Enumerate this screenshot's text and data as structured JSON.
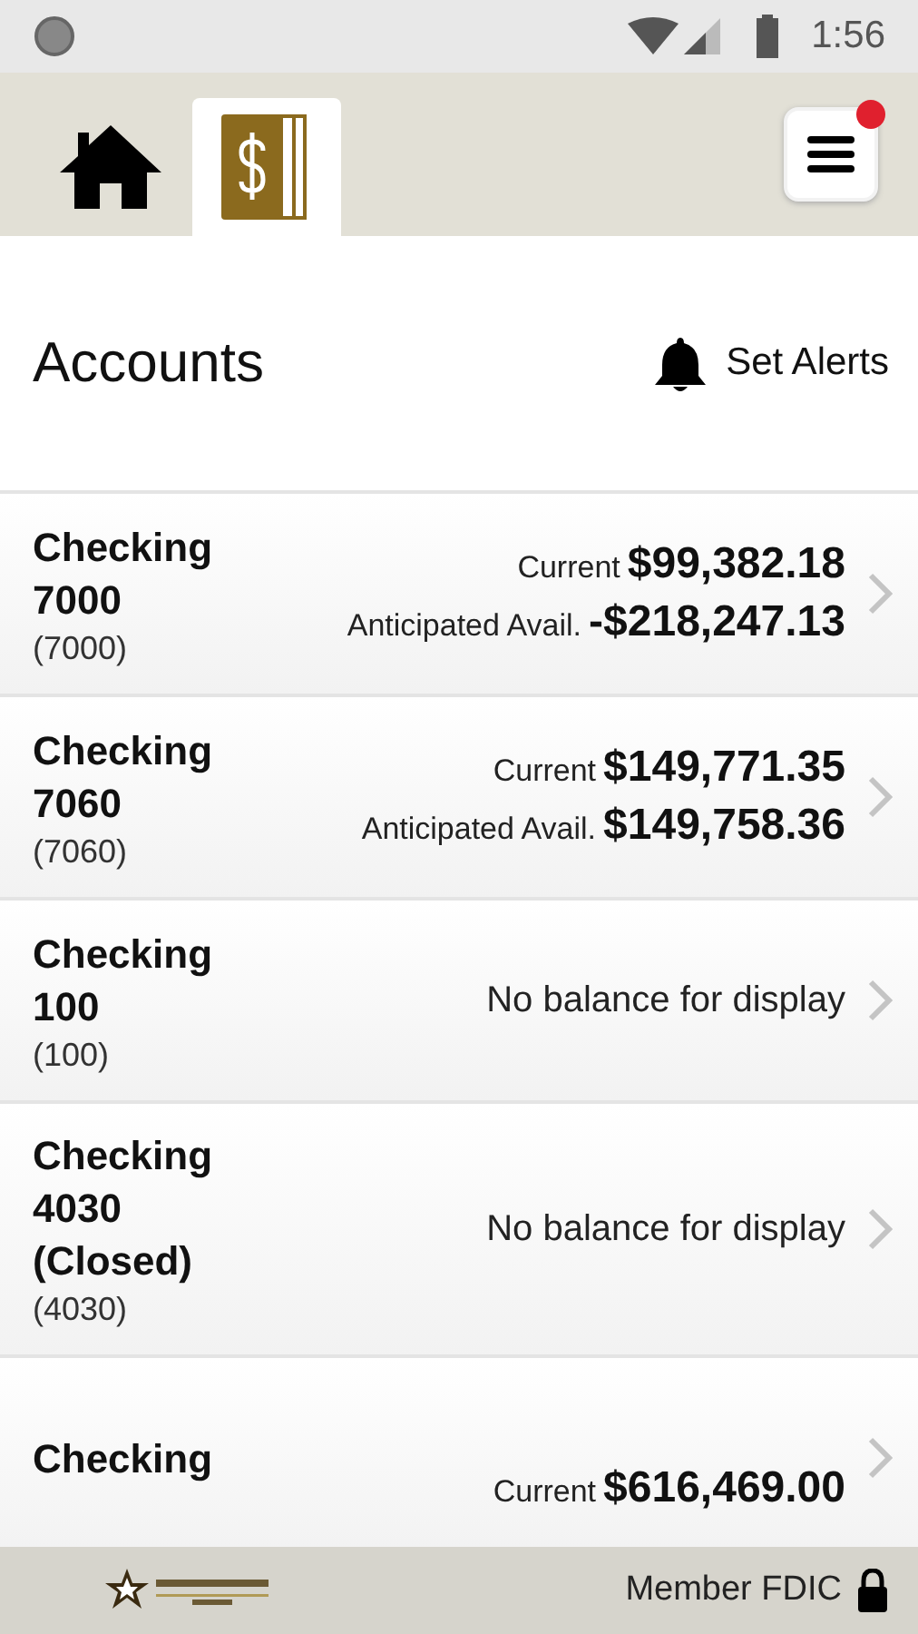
{
  "status_bar": {
    "time": "1:56"
  },
  "nav": {
    "tabs": [
      {
        "kind": "home",
        "selected": false
      },
      {
        "kind": "accounts",
        "selected": true
      }
    ],
    "menu": {
      "has_notification": true
    }
  },
  "header": {
    "title": "Accounts",
    "alerts_label": "Set Alerts"
  },
  "accounts": [
    {
      "kind": "balances",
      "name": "Checking 7000",
      "number": "(7000)",
      "balances": [
        {
          "label": "Current",
          "amount": "$99,382.18"
        },
        {
          "label": "Anticipated Avail.",
          "amount": "-$218,247.13"
        }
      ]
    },
    {
      "kind": "balances",
      "name": "Checking 7060",
      "number": "(7060)",
      "balances": [
        {
          "label": "Current",
          "amount": "$149,771.35"
        },
        {
          "label": "Anticipated Avail.",
          "amount": "$149,758.36"
        }
      ]
    },
    {
      "kind": "no_balance",
      "name": "Checking 100",
      "number": "(100)",
      "message": "No balance for display"
    },
    {
      "kind": "no_balance",
      "name": "Checking 4030 (Closed)",
      "number": "(4030)",
      "message": "No balance for display"
    },
    {
      "kind": "balances",
      "name": "Checking",
      "balances": [
        {
          "label": "Current",
          "amount": "$616,469.00"
        }
      ]
    }
  ],
  "footer": {
    "fdic": "Member FDIC"
  }
}
